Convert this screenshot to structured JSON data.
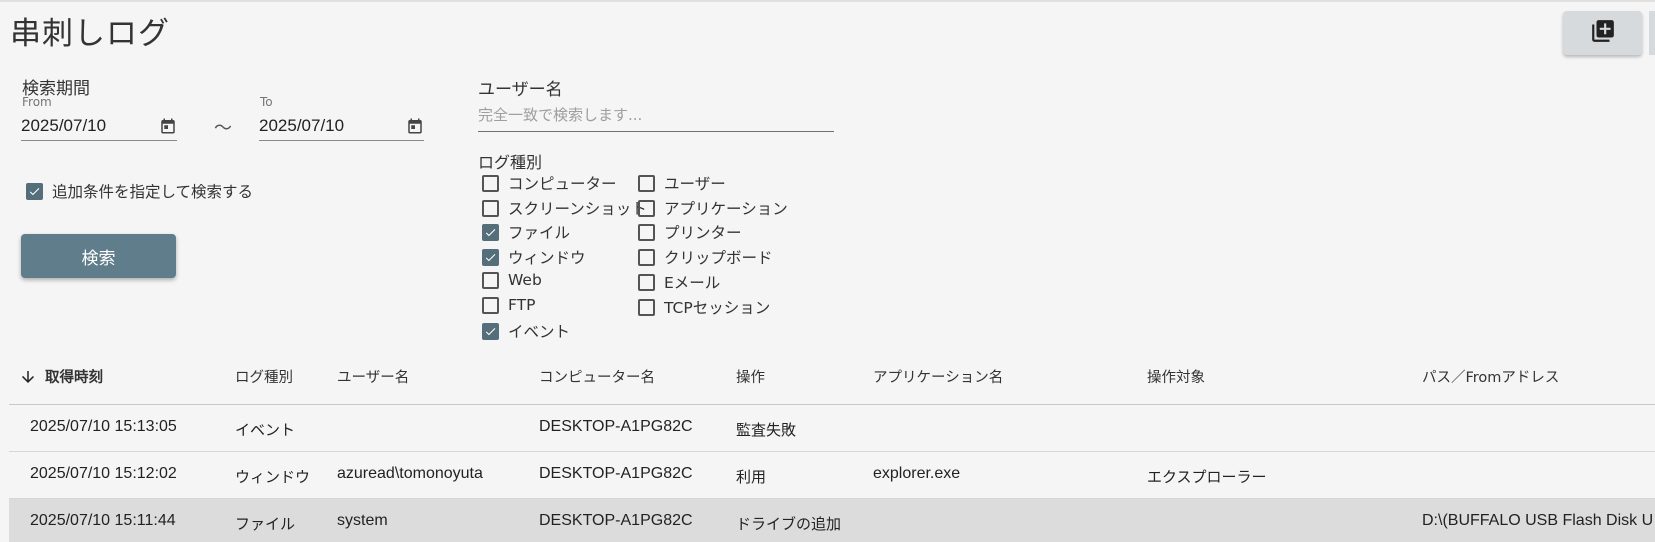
{
  "header": {
    "title": "串刺しログ",
    "add_button_icon": "library-add-icon"
  },
  "period": {
    "label": "検索期間",
    "from_label": "From",
    "from_value": "2025/07/10",
    "tilde": "〜",
    "to_label": "To",
    "to_value": "2025/07/10"
  },
  "additional": {
    "label": "追加条件を指定して検索する",
    "checked": true
  },
  "search_button": "検索",
  "username": {
    "label": "ユーザー名",
    "placeholder": "完全一致で検索します..."
  },
  "logtype": {
    "label": "ログ種別",
    "col1": [
      {
        "label": "コンピューター",
        "checked": false
      },
      {
        "label": "スクリーンショット",
        "checked": false
      },
      {
        "label": "ファイル",
        "checked": true
      },
      {
        "label": "ウィンドウ",
        "checked": true
      },
      {
        "label": "Web",
        "checked": false
      },
      {
        "label": "FTP",
        "checked": false
      },
      {
        "label": "イベント",
        "checked": true
      }
    ],
    "col2": [
      {
        "label": "ユーザー",
        "checked": false
      },
      {
        "label": "アプリケーション",
        "checked": false
      },
      {
        "label": "プリンター",
        "checked": false
      },
      {
        "label": "クリップボード",
        "checked": false
      },
      {
        "label": "Eメール",
        "checked": false
      },
      {
        "label": "TCPセッション",
        "checked": false
      }
    ]
  },
  "table": {
    "sort_icon": "arrow-down-icon",
    "columns": [
      "取得時刻",
      "ログ種別",
      "ユーザー名",
      "コンピューター名",
      "操作",
      "アプリケーション名",
      "操作対象",
      "パス／Fromアドレス"
    ],
    "rows": [
      [
        "2025/07/10 15:13:05",
        "イベント",
        "",
        "DESKTOP-A1PG82C",
        "監査失敗",
        "",
        "",
        ""
      ],
      [
        "2025/07/10 15:12:02",
        "ウィンドウ",
        "azuread\\tomonoyuta",
        "DESKTOP-A1PG82C",
        "利用",
        "explorer.exe",
        "エクスプローラー",
        ""
      ],
      [
        "2025/07/10 15:11:44",
        "ファイル",
        "system",
        "DESKTOP-A1PG82C",
        "ドライブの追加",
        "",
        "",
        "D:\\(BUFFALO USB Flash Disk U"
      ]
    ]
  }
}
